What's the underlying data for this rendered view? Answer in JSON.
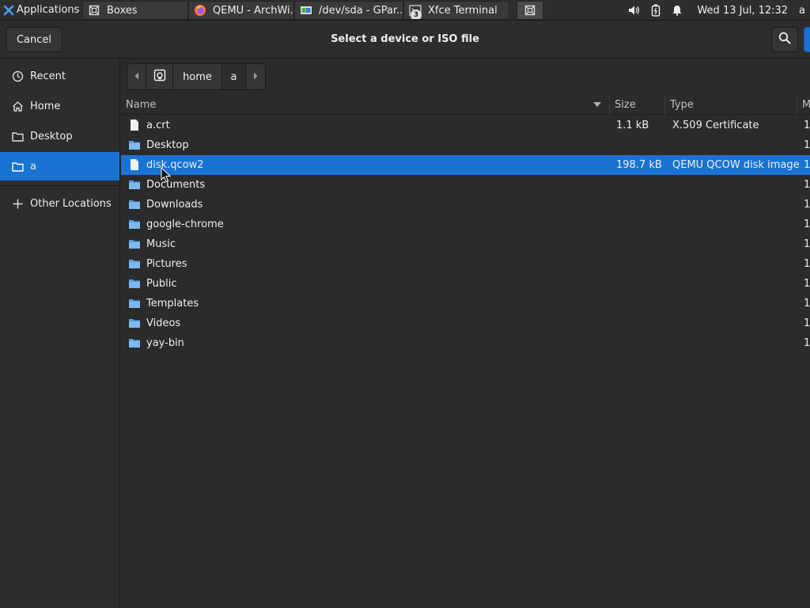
{
  "panel": {
    "applications_label": "Applications",
    "tasks": [
      {
        "label": "Boxes",
        "icon": "boxes-icon"
      },
      {
        "label": "QEMU - ArchWi...",
        "icon": "firefox-icon"
      },
      {
        "label": "/dev/sda - GPar...",
        "icon": "gparted-icon"
      },
      {
        "label": "Xfce Terminal",
        "icon": "terminal-icon",
        "badge": "3"
      },
      {
        "label": "",
        "icon": "boxes-icon"
      }
    ],
    "clock": "Wed 13 Jul, 12:32",
    "user_initial": "a"
  },
  "header": {
    "cancel_label": "Cancel",
    "title": "Select a device or ISO file"
  },
  "sidebar": {
    "items": [
      {
        "label": "Recent",
        "icon": "recent-icon"
      },
      {
        "label": "Home",
        "icon": "home-icon"
      },
      {
        "label": "Desktop",
        "icon": "folder-icon"
      },
      {
        "label": "a",
        "icon": "folder-icon",
        "selected": true
      },
      {
        "label": "Other Locations",
        "icon": "plus-icon"
      }
    ]
  },
  "pathbar": {
    "segments": [
      "home",
      "a"
    ]
  },
  "columns": {
    "name": "Name",
    "size": "Size",
    "type": "Type",
    "modified": "M"
  },
  "files": [
    {
      "name": "a.crt",
      "kind": "file",
      "size": "1.1 kB",
      "type": "X.509 Certificate",
      "mod": "1"
    },
    {
      "name": "Desktop",
      "kind": "folder",
      "size": "",
      "type": "",
      "mod": "1"
    },
    {
      "name": "disk.qcow2",
      "kind": "file",
      "size": "198.7 kB",
      "type": "QEMU QCOW disk image",
      "mod": "1",
      "selected": true
    },
    {
      "name": "Documents",
      "kind": "folder",
      "size": "",
      "type": "",
      "mod": "1"
    },
    {
      "name": "Downloads",
      "kind": "folder",
      "size": "",
      "type": "",
      "mod": "1"
    },
    {
      "name": "google-chrome",
      "kind": "folder",
      "size": "",
      "type": "",
      "mod": "1"
    },
    {
      "name": "Music",
      "kind": "folder",
      "size": "",
      "type": "",
      "mod": "1"
    },
    {
      "name": "Pictures",
      "kind": "folder",
      "size": "",
      "type": "",
      "mod": "1"
    },
    {
      "name": "Public",
      "kind": "folder",
      "size": "",
      "type": "",
      "mod": "1"
    },
    {
      "name": "Templates",
      "kind": "folder",
      "size": "",
      "type": "",
      "mod": "1"
    },
    {
      "name": "Videos",
      "kind": "folder",
      "size": "",
      "type": "",
      "mod": "1"
    },
    {
      "name": "yay-bin",
      "kind": "folder",
      "size": "",
      "type": "",
      "mod": "1"
    }
  ],
  "colors": {
    "accent": "#1a73d3",
    "folder": "#5aa0e6",
    "background": "#2b2b2b"
  }
}
